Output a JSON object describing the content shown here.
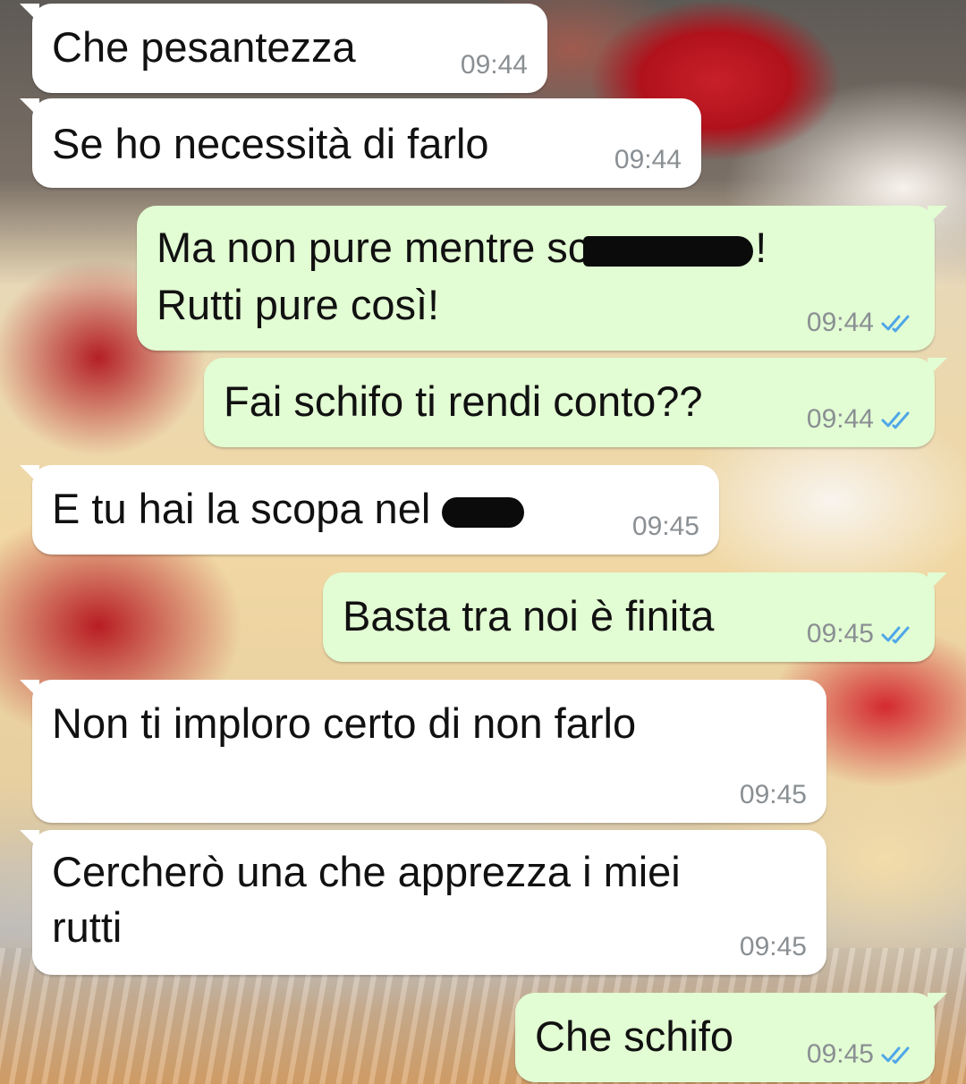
{
  "messages": [
    {
      "dir": "in",
      "text": "Che pesantezza",
      "time": "09:44"
    },
    {
      "dir": "in",
      "text": "Se ho necessità di farlo",
      "time": "09:44"
    },
    {
      "dir": "out",
      "line1_a": "Ma non pure mentre sc",
      "line1_b": "!",
      "line2": "Rutti pure così!",
      "time": "09:44",
      "status": "read"
    },
    {
      "dir": "out",
      "text": "Fai schifo ti rendi conto??",
      "time": "09:44",
      "status": "read"
    },
    {
      "dir": "in",
      "text": "E tu hai la scopa nel ",
      "time": "09:45"
    },
    {
      "dir": "out",
      "text": "Basta tra noi è finita",
      "time": "09:45",
      "status": "read"
    },
    {
      "dir": "in",
      "text": "Non ti imploro certo di non farlo",
      "time": "09:45"
    },
    {
      "dir": "in",
      "line1": "Cercherò una che apprezza i miei",
      "line2": "rutti",
      "time": "09:45"
    },
    {
      "dir": "out",
      "text": "Che schifo",
      "time": "09:45",
      "status": "read"
    }
  ],
  "colors": {
    "incoming_bubble": "#ffffff",
    "outgoing_bubble": "#e2fcd3",
    "read_check": "#4fa6e8",
    "timestamp": "#8a8f93"
  },
  "icons": {
    "read_receipt": "double-check-icon"
  }
}
